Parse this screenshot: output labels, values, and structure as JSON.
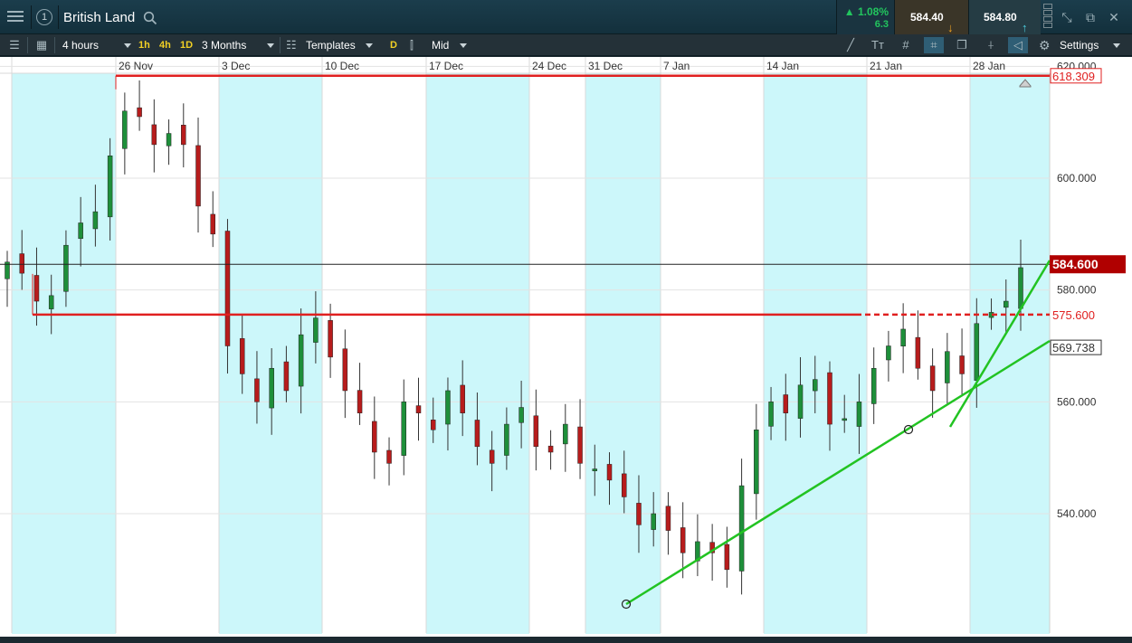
{
  "titlebar": {
    "window_number": "1",
    "instrument": "British Land",
    "change_pct": "▲ 1.08%",
    "change_abs": "6.3",
    "sell_price": "584.40",
    "buy_price": "584.80"
  },
  "toolbar": {
    "interval": "4 hours",
    "quick_intervals": [
      "1h",
      "4h",
      "1D"
    ],
    "range": "3 Months",
    "templates": "Templates",
    "d_badge": "D",
    "price_type": "Mid",
    "settings": "Settings"
  },
  "colors": {
    "accent": "#f2d024",
    "bull": "#1e8f3a",
    "bear": "#b71c1c",
    "line_red": "#e02020",
    "trend_green": "#22c322",
    "band": "#ccf7fa",
    "price_label_bg": "#b00000"
  },
  "chart_data": {
    "type": "candlestick",
    "x_ticks": [
      "26 Nov",
      "3 Dec",
      "10 Dec",
      "17 Dec",
      "24 Dec",
      "31 Dec",
      "7 Jan",
      "14 Jan",
      "21 Jan",
      "28 Jan"
    ],
    "y_ticks": [
      "620.000",
      "600.000",
      "580.000",
      "560.000",
      "540.000"
    ],
    "ylim": [
      522,
      623
    ],
    "current_price": "584.600",
    "levels": [
      {
        "value": 618.309,
        "label": "618.309",
        "style": "solid"
      },
      {
        "value": 575.6,
        "label": "575.600",
        "style": "solid-then-dashed"
      },
      {
        "value": 569.738,
        "label": "569.738",
        "style": "trendline-end"
      }
    ],
    "series_close_approx": [
      585,
      583,
      578,
      579,
      588,
      592,
      594,
      604,
      612,
      611,
      606,
      608,
      606,
      595,
      590,
      570,
      565,
      560,
      566,
      562,
      572,
      575,
      568,
      562,
      558,
      551,
      549,
      560,
      558,
      555,
      562,
      558,
      552,
      549,
      556,
      559,
      552,
      551,
      556,
      549,
      548,
      546,
      543,
      538,
      540,
      537,
      533,
      535,
      533,
      530,
      545,
      555,
      560,
      558,
      563,
      564,
      556,
      557,
      560,
      566,
      570,
      573,
      566,
      562,
      569,
      565,
      574,
      576,
      578,
      584
    ]
  }
}
